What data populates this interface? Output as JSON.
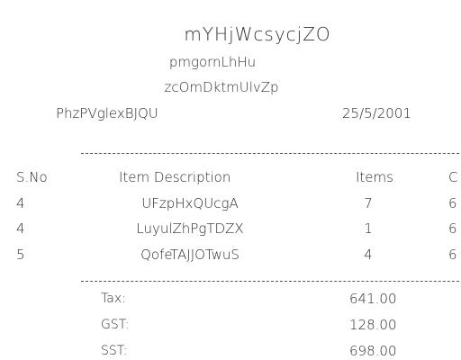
{
  "receipt": {
    "store_name": "mYHjWcsycjZO",
    "address_line1": "pmgornLhHu",
    "address_line2": "zcOmDktmUlvZp",
    "cashier": "PhzPVglexBJQU",
    "date": "25/5/2001"
  },
  "table": {
    "headers": {
      "no": "S.No",
      "description": "Item Description",
      "items": "Items",
      "cost": "C"
    },
    "rows": [
      {
        "no": "4",
        "description": "UFzpHxQUcgA",
        "items": "7",
        "cost": "6"
      },
      {
        "no": "4",
        "description": "LuyulZhPgTDZX",
        "items": "1",
        "cost": "6"
      },
      {
        "no": "5",
        "description": "QofeTAJJOTwuS",
        "items": "4",
        "cost": "6"
      }
    ]
  },
  "totals": {
    "tax_label": "Tax:",
    "tax_value": "641.00",
    "gst_label": "GST:",
    "gst_value": "128.00",
    "sst_label": "SST:",
    "sst_value": "698.00"
  }
}
